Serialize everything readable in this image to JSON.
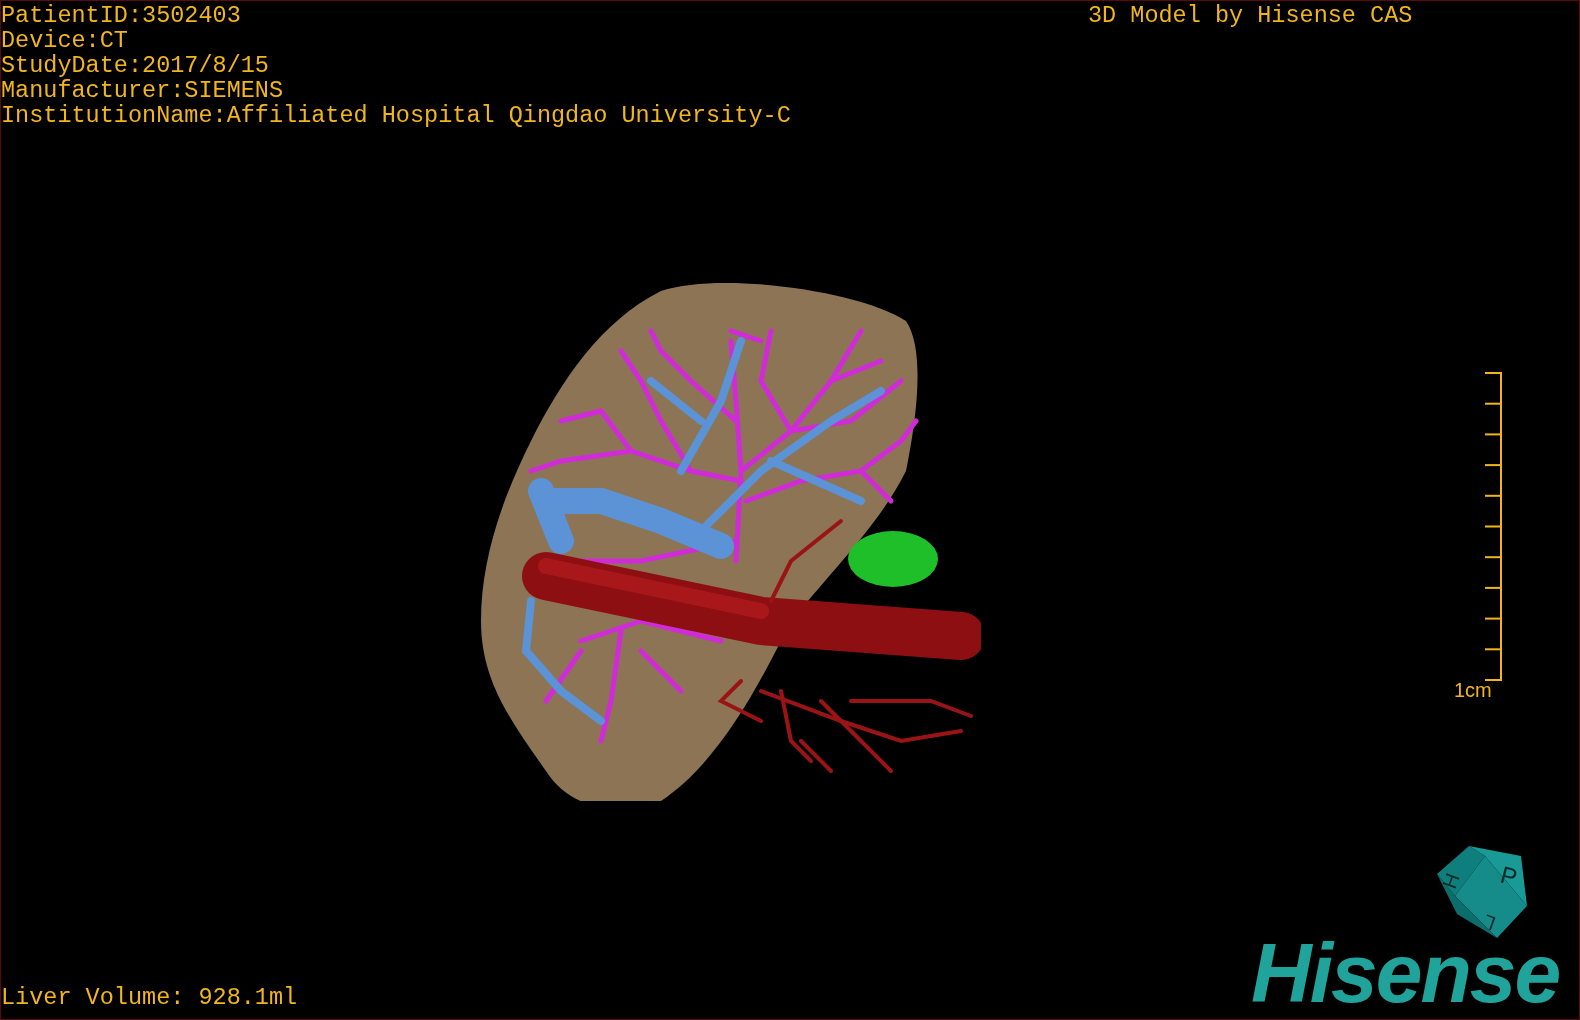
{
  "patient_info": [
    "PatientID:3502403",
    "Device:CT",
    "StudyDate:2017/8/15",
    "Manufacturer:SIEMENS",
    "InstitutionName:Affiliated Hospital Qingdao University-C"
  ],
  "credit": "3D Model by Hisense CAS",
  "scale_bar": {
    "label": "1cm"
  },
  "orientation_cube": {
    "faces": [
      "P",
      "H",
      "L"
    ]
  },
  "logo": "Hisense",
  "status": "Liver Volume: 928.1ml"
}
